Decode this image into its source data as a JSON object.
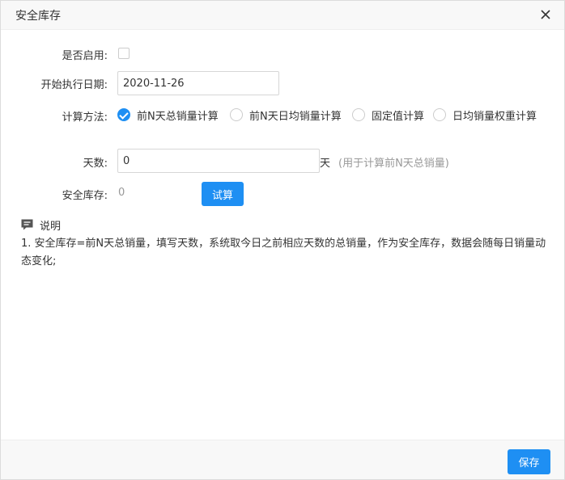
{
  "dialog": {
    "title": "安全库存"
  },
  "form": {
    "enable_label": "是否启用:",
    "enable_checked": false,
    "start_date_label": "开始执行日期:",
    "start_date_value": "2020-11-26",
    "method_label": "计算方法:",
    "methods": [
      {
        "label": "前N天总销量计算",
        "checked": true
      },
      {
        "label": "前N天日均销量计算",
        "checked": false
      },
      {
        "label": "固定值计算",
        "checked": false
      },
      {
        "label": "日均销量权重计算",
        "checked": false
      }
    ],
    "days_label": "天数:",
    "days_value": "0",
    "days_unit": "天",
    "days_hint": "(用于计算前N天总销量)",
    "safety_stock_label": "安全库存:",
    "safety_stock_value": "0",
    "calc_button": "试算"
  },
  "note": {
    "title": "说明",
    "text": "1. 安全库存=前N天总销量，填写天数，系统取今日之前相应天数的总销量，作为安全库存，数据会随每日销量动态变化;"
  },
  "footer": {
    "save_button": "保存"
  },
  "colors": {
    "primary": "#1e8ff3",
    "muted": "#999999"
  },
  "icons": {
    "close": "close-icon",
    "note": "comment-icon",
    "check": "check-icon"
  }
}
